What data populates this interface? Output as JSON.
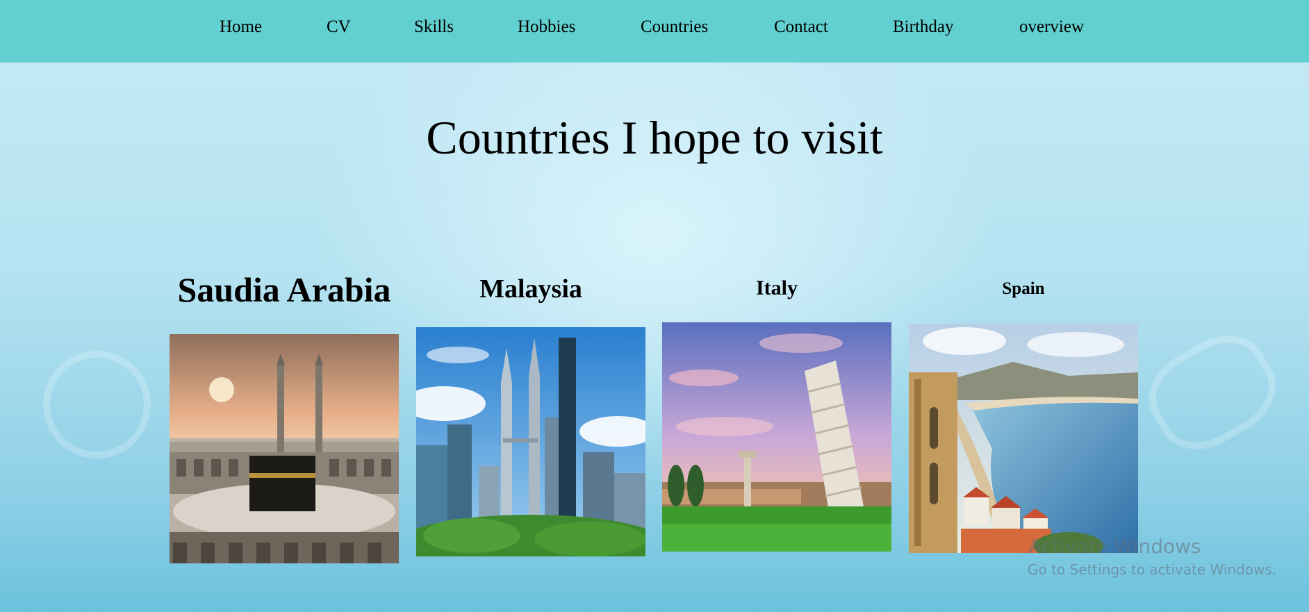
{
  "nav": {
    "items": [
      {
        "label": "Home"
      },
      {
        "label": "CV"
      },
      {
        "label": "Skills"
      },
      {
        "label": "Hobbies"
      },
      {
        "label": "Countries"
      },
      {
        "label": "Contact"
      },
      {
        "label": "Birthday"
      },
      {
        "label": "overview"
      }
    ]
  },
  "page": {
    "title": "Countries I hope to visit"
  },
  "countries": [
    {
      "name": "Saudia Arabia",
      "photo_icon": "kaaba-mecca-photo"
    },
    {
      "name": "Malaysia",
      "photo_icon": "petronas-towers-photo"
    },
    {
      "name": "Italy",
      "photo_icon": "leaning-tower-pisa-photo"
    },
    {
      "name": "Spain",
      "photo_icon": "spanish-coast-photo"
    }
  ],
  "watermark": {
    "line1": "Activate Windows",
    "line2": "Go to Settings to activate Windows."
  },
  "colors": {
    "nav_bg": "#62d0d0",
    "page_bg": "#b5e2f1"
  }
}
